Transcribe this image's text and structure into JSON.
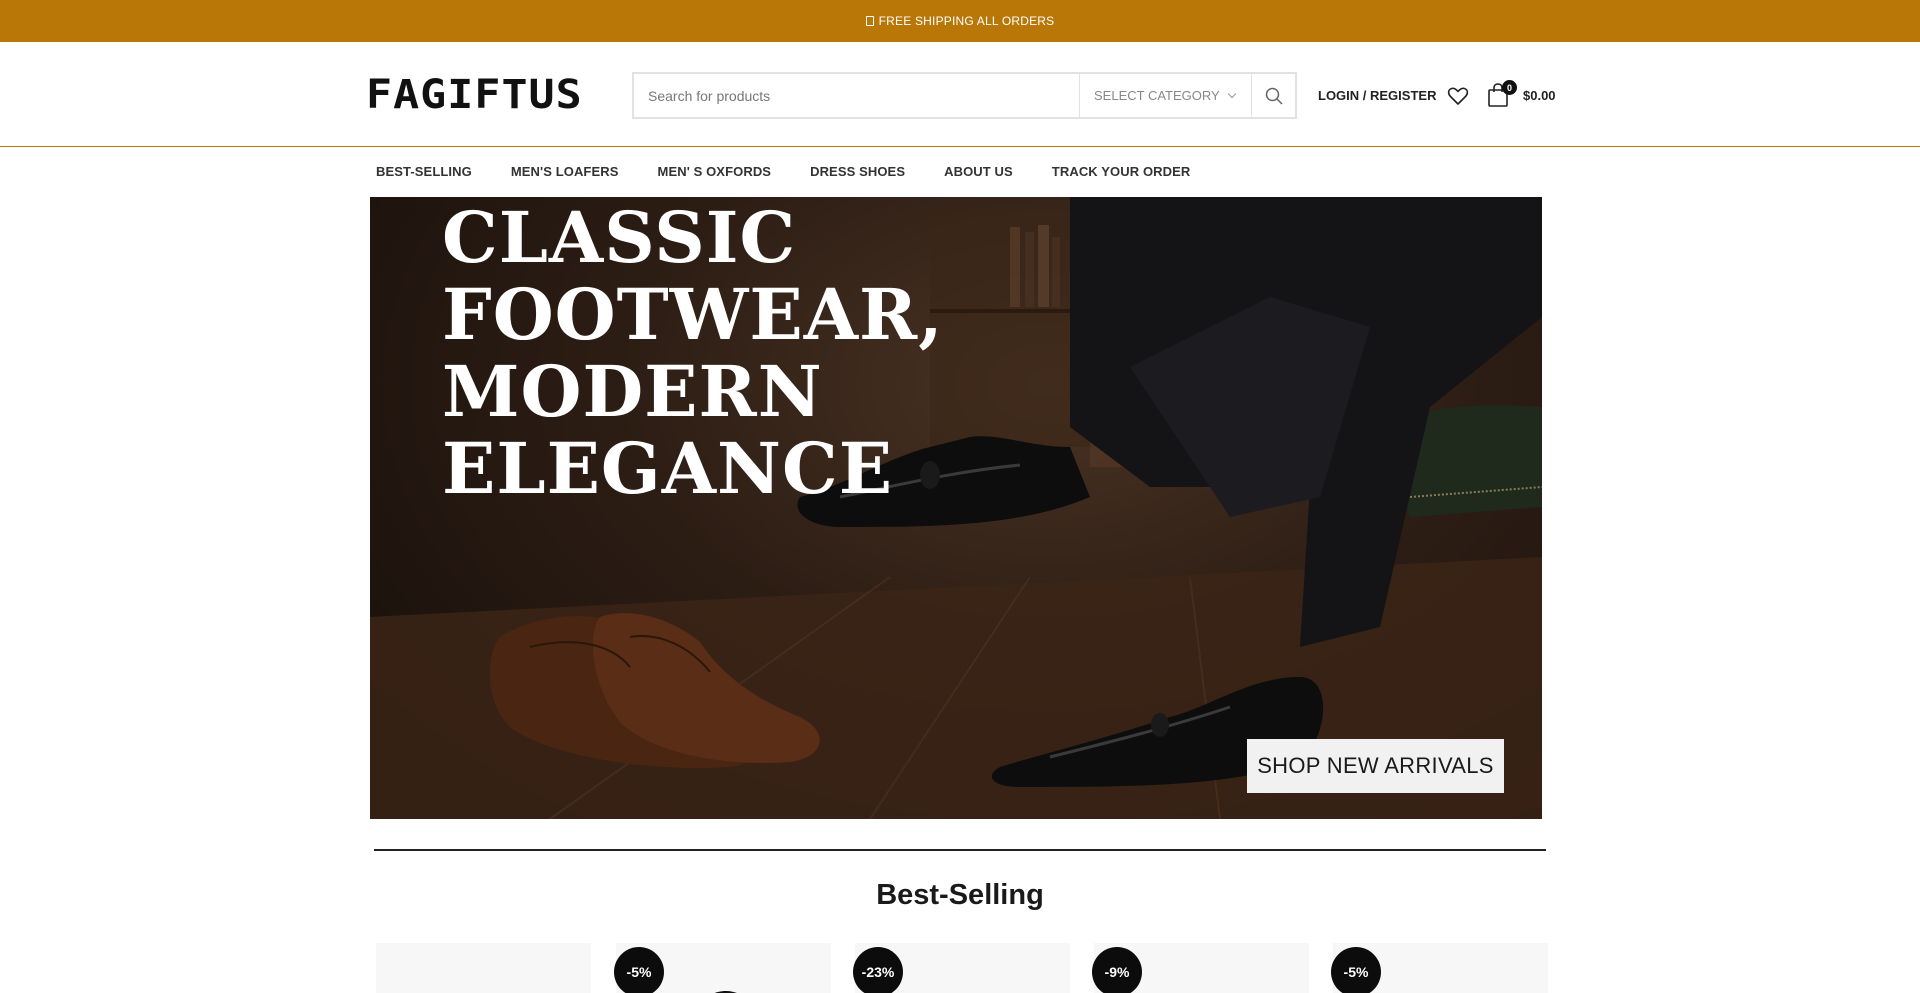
{
  "topbar": {
    "text": "FREE SHIPPING ALL ORDERS",
    "icon": "truck-icon"
  },
  "header": {
    "logo": "FAGIFTUS",
    "search": {
      "placeholder": "Search for products",
      "value": ""
    },
    "category": "SELECT CATEGORY",
    "login": "LOGIN / REGISTER",
    "cart_count": "0",
    "cart_total": "$0.00"
  },
  "nav": {
    "items": [
      {
        "label": "BEST-SELLING"
      },
      {
        "label": "MEN'S LOAFERS"
      },
      {
        "label": "MEN' S OXFORDS"
      },
      {
        "label": "DRESS SHOES"
      },
      {
        "label": "ABOUT US"
      },
      {
        "label": "TRACK YOUR ORDER"
      }
    ]
  },
  "hero": {
    "headline": "CLASSIC FOOTWEAR, MODERN ELEGANCE",
    "cta": "SHOP NEW ARRIVALS"
  },
  "best_selling": {
    "title": "Best-Selling",
    "badges": [
      "-5%",
      "-23%",
      "-9%",
      "-5%"
    ]
  },
  "colors": {
    "accent": "#b87706",
    "text": "#222222",
    "badge": "#0c0c0c"
  }
}
